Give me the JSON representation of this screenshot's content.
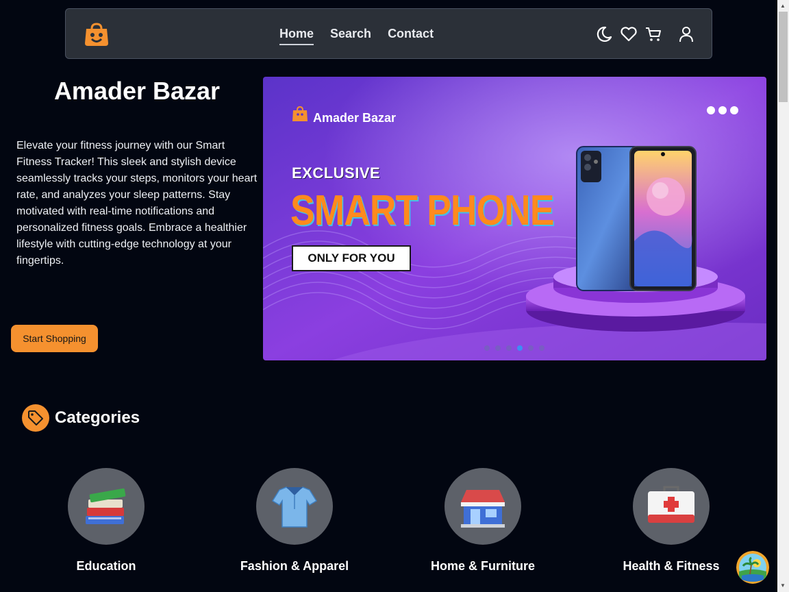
{
  "header": {
    "logo_icon": "shopping-bag-smile-icon",
    "nav": [
      {
        "label": "Home",
        "active": true
      },
      {
        "label": "Search",
        "active": false
      },
      {
        "label": "Contact",
        "active": false
      }
    ],
    "icons": [
      "moon-icon",
      "heart-icon",
      "cart-icon",
      "user-icon"
    ]
  },
  "hero": {
    "title": "Amader Bazar",
    "description": "Elevate your fitness journey with our Smart Fitness Tracker! This sleek and stylish device seamlessly tracks your steps, monitors your heart rate, and analyzes your sleep patterns. Stay motivated with real-time notifications and personalized fitness goals. Embrace a healthier lifestyle with cutting-edge technology at your fingertips.",
    "cta_label": "Start Shopping"
  },
  "banner": {
    "brand": "Amader Bazar",
    "exclusive": "EXCLUSIVE",
    "headline": "SMART PHONE",
    "tag": "ONLY FOR YOU",
    "slide_count": 6,
    "active_slide": 4
  },
  "categories": {
    "title": "Categories",
    "items": [
      {
        "label": "Education",
        "icon": "books-icon"
      },
      {
        "label": "Fashion & Apparel",
        "icon": "shirt-icon"
      },
      {
        "label": "Home & Furniture",
        "icon": "store-icon"
      },
      {
        "label": "Health & Fitness",
        "icon": "first-aid-kit-icon"
      }
    ]
  },
  "colors": {
    "background": "#020611",
    "navbar": "#2b3038",
    "accent": "#f5912f",
    "category_circle": "#5d6169"
  }
}
